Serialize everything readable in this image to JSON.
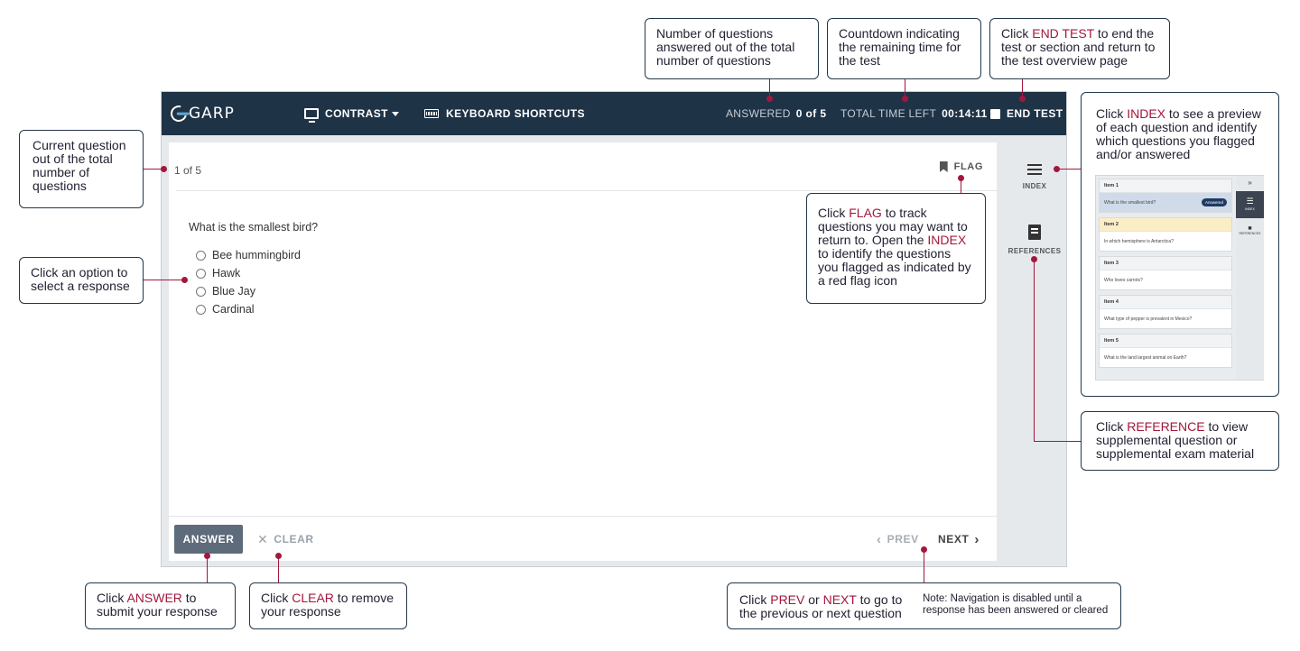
{
  "app": {
    "logo": "GARP",
    "contrast_label": "CONTRAST",
    "shortcuts_label": "KEYBOARD SHORTCUTS",
    "answered_label": "ANSWERED",
    "answered_value": "0 of 5",
    "time_label": "TOTAL TIME LEFT",
    "time_value": "00:14:11",
    "end_test_label": "END TEST"
  },
  "question": {
    "counter": "1 of 5",
    "flag_label": "FLAG",
    "text": "What is the smallest bird?",
    "options": [
      "Bee hummingbird",
      "Hawk",
      "Blue Jay",
      "Cardinal"
    ]
  },
  "footer": {
    "answer_label": "ANSWER",
    "clear_label": "CLEAR",
    "prev_label": "PREV",
    "next_label": "NEXT"
  },
  "rail": {
    "index_label": "INDEX",
    "references_label": "REFERENCES"
  },
  "callouts": {
    "answered": "Number of questions answered out of the total number of questions",
    "countdown": "Countdown indicating the remaining time for the test",
    "end_test": {
      "pre": "Click ",
      "hl": "END TEST",
      "post": " to end the test or section and return to the test overview page"
    },
    "current": "Current question out of the total number of questions",
    "option": "Click an option to select a response",
    "index": {
      "pre": "Click ",
      "hl": "INDEX",
      "post": " to see a preview of each question and identify which questions you flagged and/or answered"
    },
    "flag": {
      "pre": "Click ",
      "hl": "FLAG",
      "mid": " to track questions you may want to return to. Open the ",
      "hl2": "INDEX",
      "post": " to identify the questions you flagged as indicated by a red flag icon"
    },
    "reference": {
      "pre": "Click ",
      "hl": "REFERENCE",
      "post": " to view supplemental question or supplemental exam material"
    },
    "answer": {
      "pre": "Click ",
      "hl": "ANSWER",
      "post": " to submit your response"
    },
    "clear": {
      "pre": "Click ",
      "hl": "CLEAR",
      "post": " to remove your response"
    },
    "nav": {
      "pre": "Click ",
      "hl": "PREV",
      "mid": " or ",
      "hl2": "NEXT",
      "post": " to go to the previous or next question"
    },
    "nav_note": "Note: Navigation is disabled until a response has been answered or cleared"
  },
  "preview": {
    "items": [
      {
        "label": "Item 1",
        "question": "What is the smallest bird?",
        "badge": "Answered"
      },
      {
        "label": "Item 2",
        "question": "In which hemisphere is Antarctica?"
      },
      {
        "label": "Item 3",
        "question": "Who loves carrots?"
      },
      {
        "label": "Item 4",
        "question": "What type of pepper is prevalent in Mexico?"
      },
      {
        "label": "Item 5",
        "question": "What is the land largest animal on Earth?"
      }
    ],
    "rail_expand": "»",
    "rail_index": "INDEX",
    "rail_references": "REFERENCES"
  }
}
